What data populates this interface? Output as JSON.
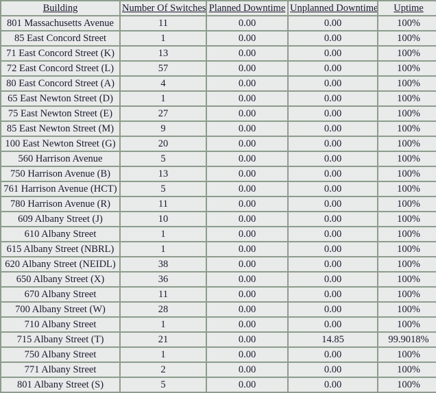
{
  "table": {
    "columns": [
      {
        "key": "building",
        "label": "Building"
      },
      {
        "key": "switches",
        "label": "Number Of Switches"
      },
      {
        "key": "planned",
        "label": "Planned Downtime"
      },
      {
        "key": "unplanned",
        "label": "Unplanned Downtime"
      },
      {
        "key": "uptime",
        "label": "Uptime"
      }
    ],
    "colors": {
      "grid": "#8c9c8c",
      "cell_background": "#e9eaea",
      "alert_background": "#edb2a8",
      "text": "#1a1a2e"
    },
    "rows": [
      {
        "building": "801 Massachusetts Avenue",
        "switches": "11",
        "planned": "0.00",
        "unplanned": "0.00",
        "uptime": "100%",
        "alert": false
      },
      {
        "building": "85 East Concord Street",
        "switches": "1",
        "planned": "0.00",
        "unplanned": "0.00",
        "uptime": "100%",
        "alert": false
      },
      {
        "building": "71 East Concord Street (K)",
        "switches": "13",
        "planned": "0.00",
        "unplanned": "0.00",
        "uptime": "100%",
        "alert": false
      },
      {
        "building": "72 East Concord Street (L)",
        "switches": "57",
        "planned": "0.00",
        "unplanned": "0.00",
        "uptime": "100%",
        "alert": false
      },
      {
        "building": "80 East Concord Street (A)",
        "switches": "4",
        "planned": "0.00",
        "unplanned": "0.00",
        "uptime": "100%",
        "alert": false
      },
      {
        "building": "65 East Newton Street (D)",
        "switches": "1",
        "planned": "0.00",
        "unplanned": "0.00",
        "uptime": "100%",
        "alert": false
      },
      {
        "building": "75 East Newton Street (E)",
        "switches": "27",
        "planned": "0.00",
        "unplanned": "0.00",
        "uptime": "100%",
        "alert": false
      },
      {
        "building": "85 East Newton Street (M)",
        "switches": "9",
        "planned": "0.00",
        "unplanned": "0.00",
        "uptime": "100%",
        "alert": false
      },
      {
        "building": "100 East Newton Street (G)",
        "switches": "20",
        "planned": "0.00",
        "unplanned": "0.00",
        "uptime": "100%",
        "alert": false
      },
      {
        "building": "560 Harrison Avenue",
        "switches": "5",
        "planned": "0.00",
        "unplanned": "0.00",
        "uptime": "100%",
        "alert": false
      },
      {
        "building": "750 Harrison Avenue (B)",
        "switches": "13",
        "planned": "0.00",
        "unplanned": "0.00",
        "uptime": "100%",
        "alert": false
      },
      {
        "building": "761 Harrison Avenue (HCT)",
        "switches": "5",
        "planned": "0.00",
        "unplanned": "0.00",
        "uptime": "100%",
        "alert": false
      },
      {
        "building": "780 Harrison Avenue (R)",
        "switches": "11",
        "planned": "0.00",
        "unplanned": "0.00",
        "uptime": "100%",
        "alert": false
      },
      {
        "building": "609 Albany Street (J)",
        "switches": "10",
        "planned": "0.00",
        "unplanned": "0.00",
        "uptime": "100%",
        "alert": false
      },
      {
        "building": "610 Albany Street",
        "switches": "1",
        "planned": "0.00",
        "unplanned": "0.00",
        "uptime": "100%",
        "alert": false
      },
      {
        "building": "615 Albany Street (NBRL)",
        "switches": "1",
        "planned": "0.00",
        "unplanned": "0.00",
        "uptime": "100%",
        "alert": false
      },
      {
        "building": "620 Albany Street (NEIDL)",
        "switches": "38",
        "planned": "0.00",
        "unplanned": "0.00",
        "uptime": "100%",
        "alert": false
      },
      {
        "building": "650 Albany Street (X)",
        "switches": "36",
        "planned": "0.00",
        "unplanned": "0.00",
        "uptime": "100%",
        "alert": false
      },
      {
        "building": "670 Albany Street",
        "switches": "11",
        "planned": "0.00",
        "unplanned": "0.00",
        "uptime": "100%",
        "alert": false
      },
      {
        "building": "700 Albany Street (W)",
        "switches": "28",
        "planned": "0.00",
        "unplanned": "0.00",
        "uptime": "100%",
        "alert": false
      },
      {
        "building": "710 Albany Street",
        "switches": "1",
        "planned": "0.00",
        "unplanned": "0.00",
        "uptime": "100%",
        "alert": false
      },
      {
        "building": "715 Albany Street (T)",
        "switches": "21",
        "planned": "0.00",
        "unplanned": "14.85",
        "uptime": "99.9018%",
        "alert": true
      },
      {
        "building": "750 Albany Street",
        "switches": "1",
        "planned": "0.00",
        "unplanned": "0.00",
        "uptime": "100%",
        "alert": false
      },
      {
        "building": "771 Albany Street",
        "switches": "2",
        "planned": "0.00",
        "unplanned": "0.00",
        "uptime": "100%",
        "alert": false
      },
      {
        "building": "801 Albany Street (S)",
        "switches": "5",
        "planned": "0.00",
        "unplanned": "0.00",
        "uptime": "100%",
        "alert": false
      }
    ]
  }
}
